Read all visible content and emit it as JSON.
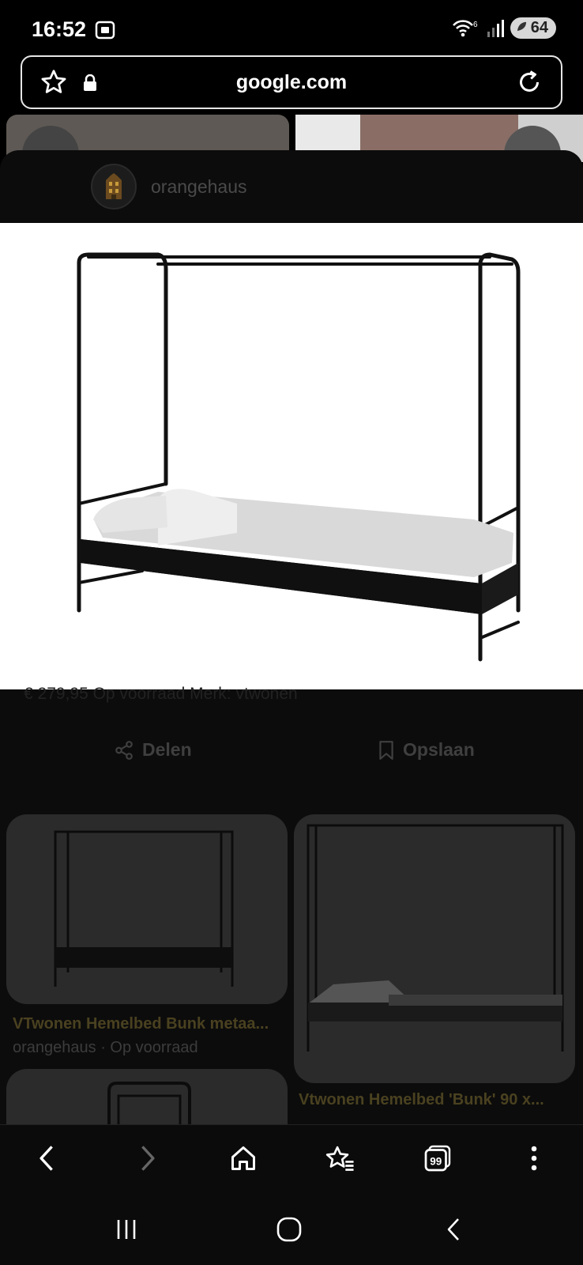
{
  "status": {
    "time": "16:52",
    "wifi_badge": "6",
    "battery": "64"
  },
  "browser": {
    "url": "google.com"
  },
  "viewer": {
    "source_name": "orangehaus",
    "actions": {
      "share_label": "Delen",
      "save_label": "Opslaan"
    }
  },
  "related": [
    {
      "title": "VTwonen Hemelbed Bunk metaa...",
      "subtitle": "orangehaus · Op voorraad"
    },
    {
      "title": "Vtwonen Hemelbed 'Bunk' 90 x..."
    }
  ],
  "nav": {
    "tabs_count": "99"
  },
  "icons": {
    "status": [
      "screen-record-icon",
      "wifi-icon",
      "signal-icon",
      "battery-icon"
    ],
    "url_bar": [
      "star-icon",
      "lock-icon",
      "reload-icon"
    ],
    "browser_nav": [
      "back-icon",
      "forward-icon",
      "home-icon",
      "bookmarks-icon",
      "tabs-icon",
      "menu-icon"
    ],
    "system_nav": [
      "recents-icon",
      "home-circle-icon",
      "system-back-icon"
    ]
  }
}
